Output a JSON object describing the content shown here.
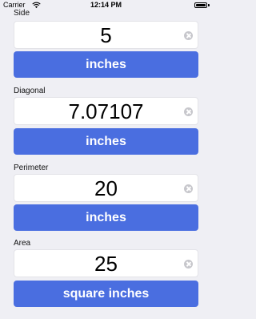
{
  "status_bar": {
    "carrier": "Carrier",
    "time": "12:14 PM"
  },
  "fields": [
    {
      "label": "Side",
      "value": "5",
      "unit": "inches"
    },
    {
      "label": "Diagonal",
      "value": "7.07107",
      "unit": "inches"
    },
    {
      "label": "Perimeter",
      "value": "20",
      "unit": "inches"
    },
    {
      "label": "Area",
      "value": "25",
      "unit": "square inches"
    }
  ],
  "colors": {
    "button": "#4a6ee0",
    "background": "#efeff4"
  }
}
